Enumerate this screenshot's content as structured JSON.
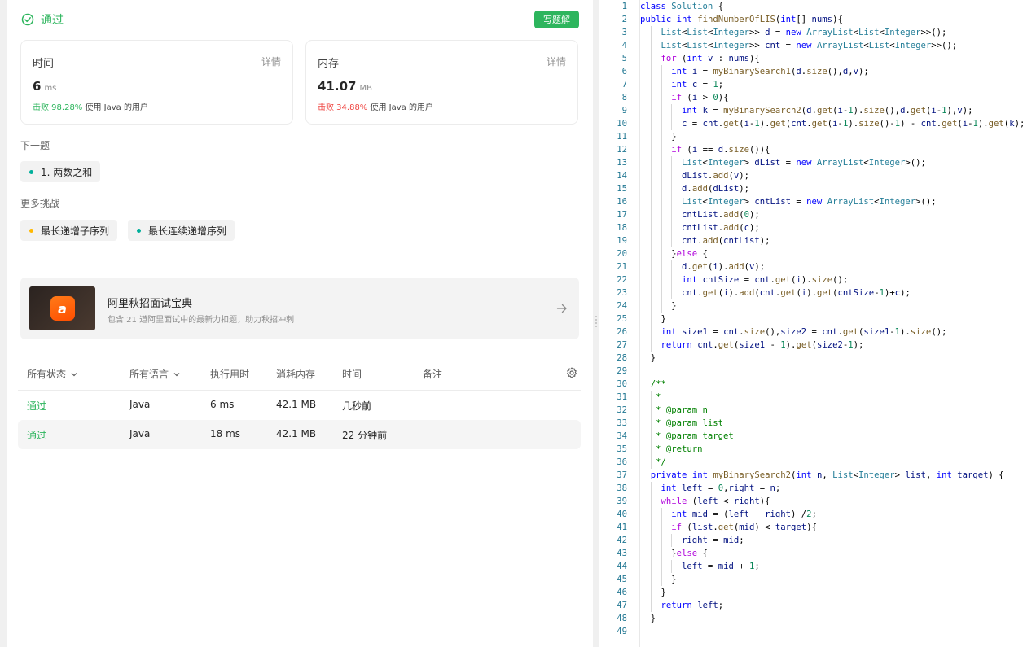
{
  "result": {
    "status": "通过",
    "write_solution": "写题解"
  },
  "runtime_card": {
    "title": "时间",
    "detail": "详情",
    "value": "6",
    "unit": "ms",
    "beat_pct": "击败 98.28%",
    "beat_suffix": "使用 Java 的用户"
  },
  "memory_card": {
    "title": "内存",
    "detail": "详情",
    "value": "41.07",
    "unit": "MB",
    "beat_pct": "击败 34.88%",
    "beat_suffix": "使用 Java 的用户"
  },
  "next_question": {
    "label": "下一题",
    "item": "1. 两数之和"
  },
  "more_challenges": {
    "label": "更多挑战",
    "items": [
      "最长递增子序列",
      "最长连续递增序列"
    ]
  },
  "banner": {
    "title": "阿里秋招面试宝典",
    "subtitle": "包含 21 道阿里面试中的最新力扣题，助力秋招冲刺",
    "logo_text": "a"
  },
  "table": {
    "headers": {
      "status": "所有状态",
      "language": "所有语言",
      "runtime": "执行用时",
      "memory": "消耗内存",
      "time": "时间",
      "note": "备注"
    },
    "rows": [
      {
        "status": "通过",
        "language": "Java",
        "runtime": "6 ms",
        "memory": "42.1 MB",
        "time": "几秒前"
      },
      {
        "status": "通过",
        "language": "Java",
        "runtime": "18 ms",
        "memory": "42.1 MB",
        "time": "22 分钟前"
      }
    ]
  },
  "code_lines": [
    "class Solution {",
    "public int findNumberOfLIS(int[] nums){",
    "    List<List<Integer>> d = new ArrayList<List<Integer>>();",
    "    List<List<Integer>> cnt = new ArrayList<List<Integer>>();",
    "    for (int v : nums){",
    "      int i = myBinarySearch1(d.size(),d,v);",
    "      int c = 1;",
    "      if (i > 0){",
    "        int k = myBinarySearch2(d.get(i-1).size(),d.get(i-1),v);",
    "        c = cnt.get(i-1).get(cnt.get(i-1).size()-1) - cnt.get(i-1).get(k);",
    "      }",
    "      if (i == d.size()){",
    "        List<Integer> dList = new ArrayList<Integer>();",
    "        dList.add(v);",
    "        d.add(dList);",
    "        List<Integer> cntList = new ArrayList<Integer>();",
    "        cntList.add(0);",
    "        cntList.add(c);",
    "        cnt.add(cntList);",
    "      }else {",
    "        d.get(i).add(v);",
    "        int cntSize = cnt.get(i).size();",
    "        cnt.get(i).add(cnt.get(i).get(cntSize-1)+c);",
    "      }",
    "    }",
    "    int size1 = cnt.size(),size2 = cnt.get(size1-1).size();",
    "    return cnt.get(size1 - 1).get(size2-1);",
    "  }",
    "",
    "  /**",
    "   *",
    "   * @param n",
    "   * @param list",
    "   * @param target",
    "   * @return",
    "   */",
    "  private int myBinarySearch2(int n, List<Integer> list, int target) {",
    "    int left = 0,right = n;",
    "    while (left < right){",
    "      int mid = (left + right) /2;",
    "      if (list.get(mid) < target){",
    "        right = mid;",
    "      }else {",
    "        left = mid + 1;",
    "      }",
    "    }",
    "    return left;",
    "  }",
    ""
  ],
  "colors": {
    "accent_green": "#2db55d",
    "beat_red": "#ef4743",
    "dot_green": "#00af9b",
    "dot_yellow": "#ffb800"
  }
}
